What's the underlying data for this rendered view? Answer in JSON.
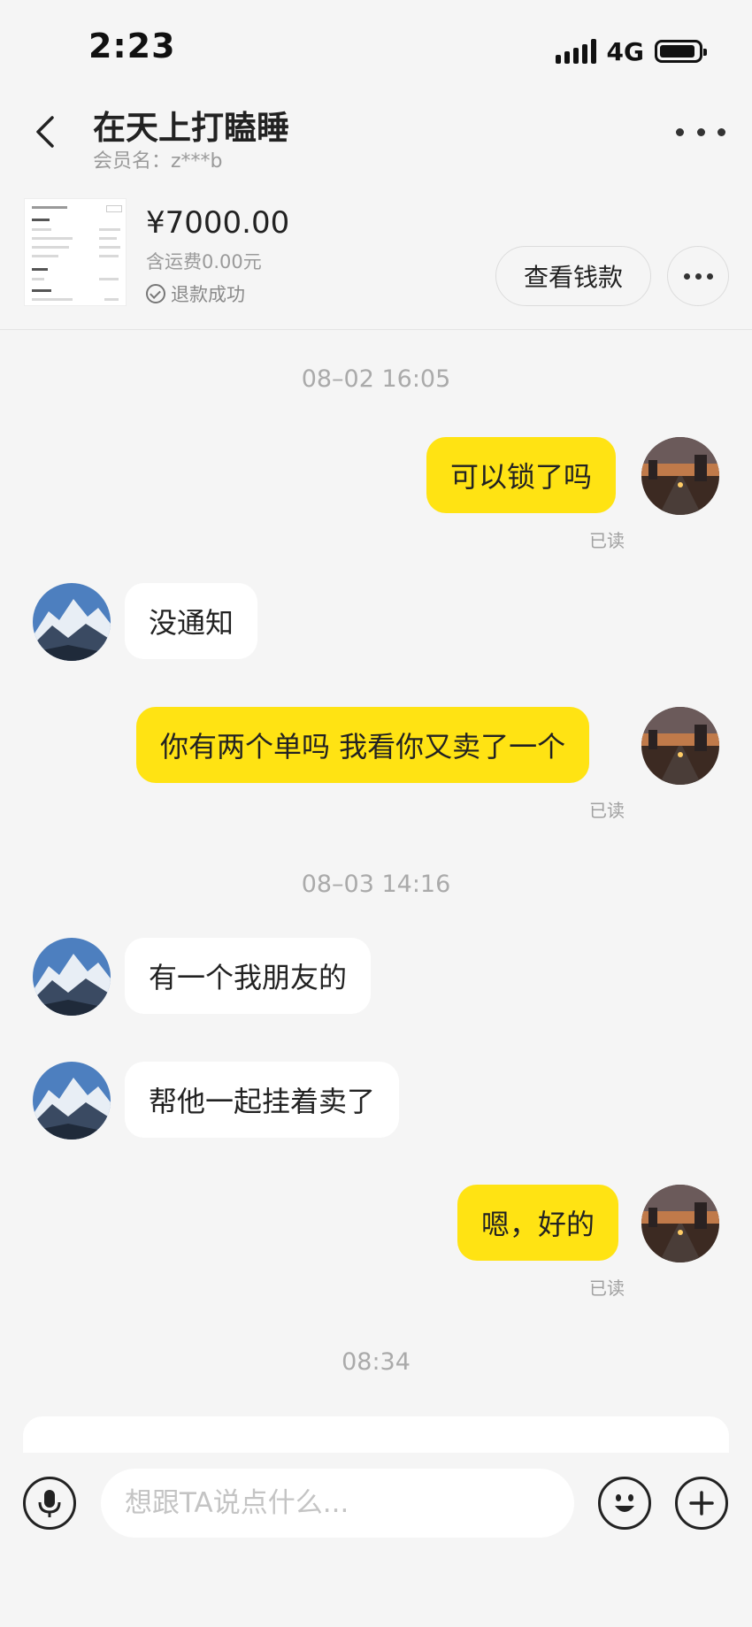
{
  "status_bar": {
    "time": "2:23",
    "network": "4G"
  },
  "header": {
    "title": "在天上打瞌睡",
    "member": "会员名：z***b"
  },
  "order": {
    "price": "¥7000.00",
    "shipping": "含运费0.00元",
    "status": "退款成功",
    "view_button": "查看钱款"
  },
  "messages": {
    "ts1": "08–02 16:05",
    "m1": "可以锁了吗",
    "m1_read": "已读",
    "m2": "没通知",
    "m3": "你有两个单吗 我看你又卖了一个",
    "m3_read": "已读",
    "ts2": "08–03 14:16",
    "m4": "有一个我朋友的",
    "m5": "帮他一起挂着卖了",
    "m6": "嗯，好的",
    "m6_read": "已读",
    "ts3": "08:34"
  },
  "input": {
    "placeholder": "想跟TA说点什么..."
  },
  "colors": {
    "my_bubble": "#ffe313",
    "their_bubble": "#ffffff",
    "background": "#f5f5f5"
  }
}
